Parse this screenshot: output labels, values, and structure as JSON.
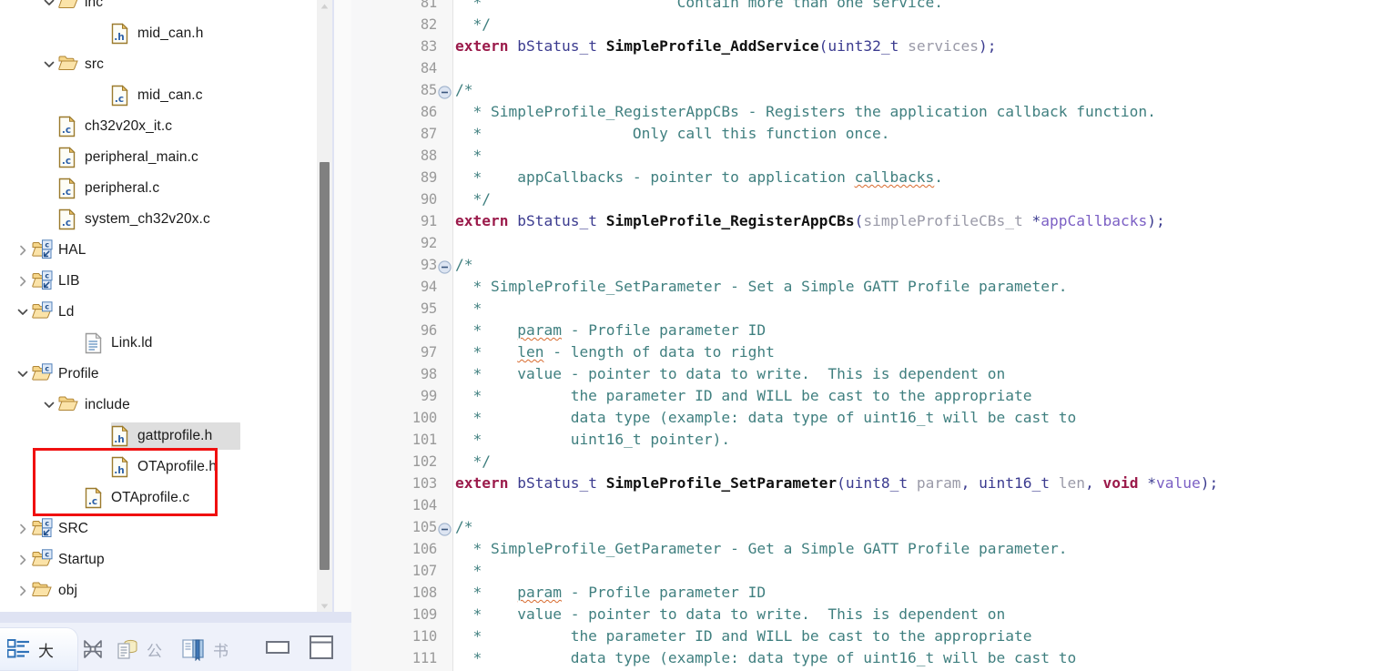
{
  "explorer": {
    "tree": [
      {
        "id": "inc",
        "label": "inc",
        "indent": 2,
        "twist": "chevron-down",
        "icon": "folder-open",
        "selected": false
      },
      {
        "id": "mid_can_h",
        "label": "mid_can.h",
        "indent": 4,
        "twist": "none",
        "icon": "file-h",
        "selected": false
      },
      {
        "id": "src",
        "label": "src",
        "indent": 2,
        "twist": "chevron-down",
        "icon": "folder-open",
        "selected": false
      },
      {
        "id": "mid_can_c",
        "label": "mid_can.c",
        "indent": 4,
        "twist": "none",
        "icon": "file-c",
        "selected": false
      },
      {
        "id": "ch32v20x_it_c",
        "label": "ch32v20x_it.c",
        "indent": 2,
        "twist": "none",
        "icon": "file-c",
        "selected": false
      },
      {
        "id": "peripheral_main_c",
        "label": "peripheral_main.c",
        "indent": 2,
        "twist": "none",
        "icon": "file-c",
        "selected": false
      },
      {
        "id": "peripheral_c",
        "label": "peripheral.c",
        "indent": 2,
        "twist": "none",
        "icon": "file-c",
        "selected": false
      },
      {
        "id": "system_ch32v20x_c",
        "label": "system_ch32v20x.c",
        "indent": 2,
        "twist": "none",
        "icon": "file-c",
        "selected": false
      },
      {
        "id": "HAL",
        "label": "HAL",
        "indent": 1,
        "twist": "chevron-right",
        "icon": "folder-csrc-link",
        "selected": false
      },
      {
        "id": "LIB",
        "label": "LIB",
        "indent": 1,
        "twist": "chevron-right",
        "icon": "folder-csrc-link",
        "selected": false
      },
      {
        "id": "Ld",
        "label": "Ld",
        "indent": 1,
        "twist": "chevron-down",
        "icon": "folder-csrc",
        "selected": false
      },
      {
        "id": "Link_ld",
        "label": "Link.ld",
        "indent": 3,
        "twist": "none",
        "icon": "file-ld",
        "selected": false
      },
      {
        "id": "Profile",
        "label": "Profile",
        "indent": 1,
        "twist": "chevron-down",
        "icon": "folder-csrc",
        "selected": false
      },
      {
        "id": "include",
        "label": "include",
        "indent": 2,
        "twist": "chevron-down",
        "icon": "folder-open",
        "selected": false
      },
      {
        "id": "gattprofile_h",
        "label": "gattprofile.h",
        "indent": 4,
        "twist": "none",
        "icon": "file-h",
        "selected": true
      },
      {
        "id": "OTAprofile_h",
        "label": "OTAprofile.h",
        "indent": 4,
        "twist": "none",
        "icon": "file-h",
        "selected": false
      },
      {
        "id": "OTAprofile_c",
        "label": "OTAprofile.c",
        "indent": 3,
        "twist": "none",
        "icon": "file-c",
        "selected": false
      },
      {
        "id": "SRC",
        "label": "SRC",
        "indent": 1,
        "twist": "chevron-right",
        "icon": "folder-csrc-link",
        "selected": false
      },
      {
        "id": "Startup",
        "label": "Startup",
        "indent": 1,
        "twist": "chevron-right",
        "icon": "folder-csrc",
        "selected": false
      },
      {
        "id": "obj",
        "label": "obj",
        "indent": 1,
        "twist": "chevron-right",
        "icon": "folder-open",
        "selected": false
      }
    ],
    "highlight": {
      "color": "#f01010",
      "targets": [
        "OTAprofile.h",
        "OTAprofile.c"
      ]
    }
  },
  "tabbar": {
    "tabs": [
      {
        "id": "outline",
        "label": "大",
        "icon": "outline-icon",
        "active": true
      },
      {
        "id": "public",
        "label": "公",
        "icon": "documents-icon",
        "active": false
      },
      {
        "id": "book",
        "label": "书",
        "icon": "book-icon",
        "active": false
      }
    ],
    "close_label": "",
    "panel_buttons": [
      {
        "id": "minimize",
        "icon": "minimize-panel-icon"
      },
      {
        "id": "restore",
        "icon": "restore-panel-icon"
      }
    ]
  },
  "editor": {
    "first_line": 81,
    "lines": [
      {
        "n": 81,
        "fold": false,
        "partial": true,
        "tokens": [
          {
            "t": "  * ",
            "c": "cm"
          },
          {
            "t": "                     Contain more than one service.",
            "c": "cm"
          }
        ]
      },
      {
        "n": 82,
        "fold": false,
        "tokens": [
          {
            "t": "  */",
            "c": "cm"
          }
        ]
      },
      {
        "n": 83,
        "fold": false,
        "tokens": [
          {
            "t": "extern",
            "c": "kw"
          },
          {
            "t": " ",
            "c": ""
          },
          {
            "t": "bStatus_t",
            "c": "ty"
          },
          {
            "t": " ",
            "c": ""
          },
          {
            "t": "SimpleProfile_AddService",
            "c": "fn"
          },
          {
            "t": "(",
            "c": "pn"
          },
          {
            "t": "uint32_t",
            "c": "ty"
          },
          {
            "t": " ",
            "c": ""
          },
          {
            "t": "services",
            "c": "pm"
          },
          {
            "t": ");",
            "c": "pn"
          }
        ]
      },
      {
        "n": 84,
        "fold": false,
        "tokens": []
      },
      {
        "n": 85,
        "fold": true,
        "tokens": [
          {
            "t": "/*",
            "c": "cm"
          }
        ]
      },
      {
        "n": 86,
        "fold": false,
        "tokens": [
          {
            "t": "  * SimpleProfile_RegisterAppCBs - Registers the application callback function.",
            "c": "cm"
          }
        ]
      },
      {
        "n": 87,
        "fold": false,
        "tokens": [
          {
            "t": "  *                 Only call this function once.",
            "c": "cm"
          }
        ]
      },
      {
        "n": 88,
        "fold": false,
        "tokens": [
          {
            "t": "  *",
            "c": "cm"
          }
        ]
      },
      {
        "n": 89,
        "fold": false,
        "tokens": [
          {
            "t": "  *    appCallbacks - pointer to application ",
            "c": "cm"
          },
          {
            "t": "callbacks",
            "c": "cm sq"
          },
          {
            "t": ".",
            "c": "cm"
          }
        ]
      },
      {
        "n": 90,
        "fold": false,
        "tokens": [
          {
            "t": "  */",
            "c": "cm"
          }
        ]
      },
      {
        "n": 91,
        "fold": false,
        "tokens": [
          {
            "t": "extern",
            "c": "kw"
          },
          {
            "t": " ",
            "c": ""
          },
          {
            "t": "bStatus_t",
            "c": "ty"
          },
          {
            "t": " ",
            "c": ""
          },
          {
            "t": "SimpleProfile_RegisterAppCBs",
            "c": "fn"
          },
          {
            "t": "(",
            "c": "pn"
          },
          {
            "t": "simpleProfileCBs_t",
            "c": "pm"
          },
          {
            "t": " *",
            "c": "pn"
          },
          {
            "t": "appCallbacks",
            "c": "vv"
          },
          {
            "t": ");",
            "c": "pn"
          }
        ]
      },
      {
        "n": 92,
        "fold": false,
        "tokens": []
      },
      {
        "n": 93,
        "fold": true,
        "tokens": [
          {
            "t": "/*",
            "c": "cm"
          }
        ]
      },
      {
        "n": 94,
        "fold": false,
        "tokens": [
          {
            "t": "  * SimpleProfile_SetParameter - Set a Simple GATT Profile parameter.",
            "c": "cm"
          }
        ]
      },
      {
        "n": 95,
        "fold": false,
        "tokens": [
          {
            "t": "  *",
            "c": "cm"
          }
        ]
      },
      {
        "n": 96,
        "fold": false,
        "tokens": [
          {
            "t": "  *    ",
            "c": "cm"
          },
          {
            "t": "param",
            "c": "cm sq"
          },
          {
            "t": " - Profile parameter ID",
            "c": "cm"
          }
        ]
      },
      {
        "n": 97,
        "fold": false,
        "tokens": [
          {
            "t": "  *    ",
            "c": "cm"
          },
          {
            "t": "len",
            "c": "cm sq"
          },
          {
            "t": " - length of data to right",
            "c": "cm"
          }
        ]
      },
      {
        "n": 98,
        "fold": false,
        "tokens": [
          {
            "t": "  *    value - pointer to data to write.  This is dependent on",
            "c": "cm"
          }
        ]
      },
      {
        "n": 99,
        "fold": false,
        "tokens": [
          {
            "t": "  *          the parameter ID and WILL be cast to the appropriate",
            "c": "cm"
          }
        ]
      },
      {
        "n": 100,
        "fold": false,
        "tokens": [
          {
            "t": "  *          data type (example: data type of uint16_t will be cast to",
            "c": "cm"
          }
        ]
      },
      {
        "n": 101,
        "fold": false,
        "tokens": [
          {
            "t": "  *          uint16_t pointer).",
            "c": "cm"
          }
        ]
      },
      {
        "n": 102,
        "fold": false,
        "tokens": [
          {
            "t": "  */",
            "c": "cm"
          }
        ]
      },
      {
        "n": 103,
        "fold": false,
        "tokens": [
          {
            "t": "extern",
            "c": "kw"
          },
          {
            "t": " ",
            "c": ""
          },
          {
            "t": "bStatus_t",
            "c": "ty"
          },
          {
            "t": " ",
            "c": ""
          },
          {
            "t": "SimpleProfile_SetParameter",
            "c": "fn"
          },
          {
            "t": "(",
            "c": "pn"
          },
          {
            "t": "uint8_t",
            "c": "ty"
          },
          {
            "t": " ",
            "c": ""
          },
          {
            "t": "param",
            "c": "pm"
          },
          {
            "t": ", ",
            "c": "pn"
          },
          {
            "t": "uint16_t",
            "c": "ty"
          },
          {
            "t": " ",
            "c": ""
          },
          {
            "t": "len",
            "c": "pm"
          },
          {
            "t": ", ",
            "c": "pn"
          },
          {
            "t": "void",
            "c": "kw"
          },
          {
            "t": " *",
            "c": "pn"
          },
          {
            "t": "value",
            "c": "vv"
          },
          {
            "t": ");",
            "c": "pn"
          }
        ]
      },
      {
        "n": 104,
        "fold": false,
        "tokens": []
      },
      {
        "n": 105,
        "fold": true,
        "tokens": [
          {
            "t": "/*",
            "c": "cm"
          }
        ]
      },
      {
        "n": 106,
        "fold": false,
        "tokens": [
          {
            "t": "  * SimpleProfile_GetParameter - Get a Simple GATT Profile parameter.",
            "c": "cm"
          }
        ]
      },
      {
        "n": 107,
        "fold": false,
        "tokens": [
          {
            "t": "  *",
            "c": "cm"
          }
        ]
      },
      {
        "n": 108,
        "fold": false,
        "tokens": [
          {
            "t": "  *    ",
            "c": "cm"
          },
          {
            "t": "param",
            "c": "cm sq"
          },
          {
            "t": " - Profile parameter ID",
            "c": "cm"
          }
        ]
      },
      {
        "n": 109,
        "fold": false,
        "tokens": [
          {
            "t": "  *    value - pointer to data to write.  This is dependent on",
            "c": "cm"
          }
        ]
      },
      {
        "n": 110,
        "fold": false,
        "tokens": [
          {
            "t": "  *          the parameter ID and WILL be cast to the appropriate",
            "c": "cm"
          }
        ]
      },
      {
        "n": 111,
        "fold": false,
        "tokens": [
          {
            "t": "  *          data type (example: data type of uint16_t will be cast to",
            "c": "cm"
          }
        ]
      }
    ]
  },
  "colors": {
    "comment": "#3f7f7f",
    "keyword": "#9b1b4b",
    "type": "#3b3b8f",
    "function": "#111111",
    "parameter": "#9a9aa8",
    "annotation": "#f01010",
    "selection": "#dedede"
  }
}
